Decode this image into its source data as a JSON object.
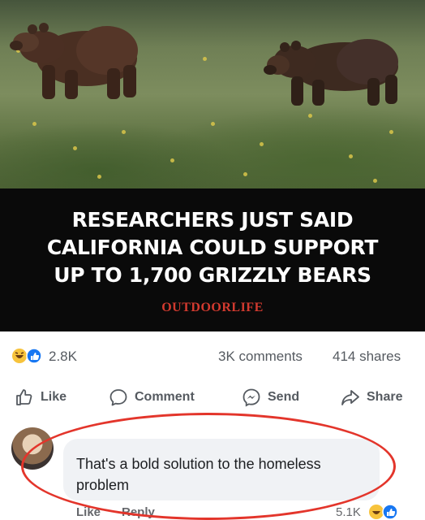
{
  "post": {
    "headline_lines": [
      "RESEARCHERS JUST SAID",
      "CALIFORNIA COULD SUPPORT",
      "UP TO 1,700 GRIZZLY BEARS"
    ],
    "brand": "OUTDOORLIFE"
  },
  "stats": {
    "reactions": "2.8K",
    "comments": "3K comments",
    "shares": "414 shares"
  },
  "actions": {
    "like": "Like",
    "comment": "Comment",
    "send": "Send",
    "share": "Share"
  },
  "comment": {
    "text": "That's a bold solution to the homeless problem",
    "like": "Like",
    "reply": "Reply",
    "reactions": "5.1K"
  },
  "colors": {
    "banner_bg": "#0a0a0a",
    "brand_red": "#d23a2f",
    "like_blue": "#1877f2",
    "haha_yellow": "#f7c33c",
    "highlight_circle": "#e3352b"
  },
  "icons": {
    "reactions": [
      "haha-icon",
      "like-icon"
    ],
    "like_action": "thumbs-up-outline-icon",
    "comment_action": "speech-bubble-icon",
    "send_action": "messenger-icon",
    "share_action": "share-arrow-icon"
  }
}
